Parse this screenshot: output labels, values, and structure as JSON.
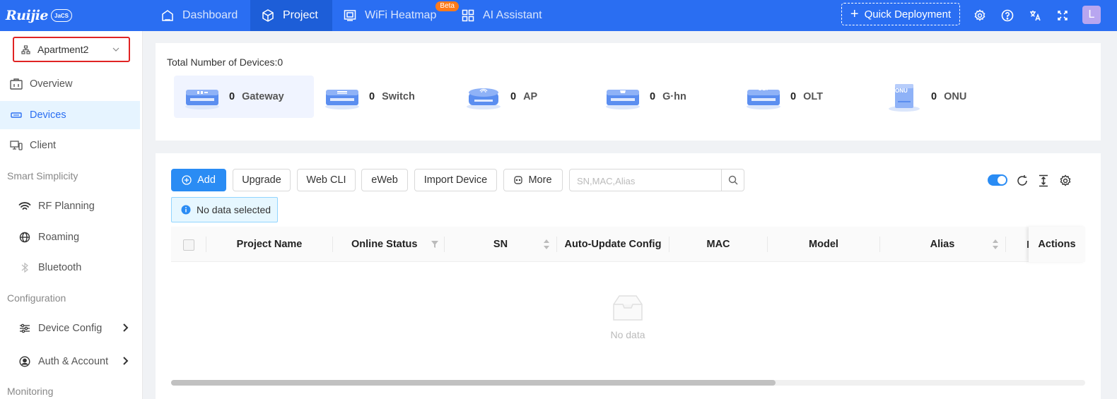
{
  "brand": {
    "logo_text": "Ruijie",
    "badge": "JaCS"
  },
  "nav": {
    "items": [
      {
        "label": "Dashboard",
        "icon": "home-icon"
      },
      {
        "label": "Project",
        "icon": "cube-icon"
      },
      {
        "label": "WiFi Heatmap",
        "icon": "heatmap-icon"
      },
      {
        "label": "AI Assistant",
        "icon": "grid-icon"
      }
    ],
    "beta_label": "Beta",
    "active": "Project",
    "quick_deployment": "Quick Deployment",
    "avatar_initial": "L"
  },
  "sidebar": {
    "project_selector": "Apartment2",
    "items": [
      {
        "label": "Overview",
        "icon": "overview-icon"
      },
      {
        "label": "Devices",
        "icon": "devices-icon",
        "active": true
      },
      {
        "label": "Client",
        "icon": "client-icon"
      }
    ],
    "groups": [
      "Smart Simplicity",
      "Configuration",
      "Monitoring"
    ],
    "smart_items": [
      {
        "label": "RF Planning",
        "icon": "wifi-icon"
      },
      {
        "label": "Roaming",
        "icon": "globe-icon"
      },
      {
        "label": "Bluetooth",
        "icon": "bluetooth-icon"
      }
    ],
    "config_items": [
      {
        "label": "Device Config",
        "icon": "sliders-icon"
      },
      {
        "label": "Auth & Account",
        "icon": "user-circle-icon"
      }
    ]
  },
  "summary": {
    "title": "Total Number of Devices:0",
    "device_types": [
      {
        "count": "0",
        "label": "Gateway"
      },
      {
        "count": "0",
        "label": "Switch"
      },
      {
        "count": "0",
        "label": "AP"
      },
      {
        "count": "0",
        "label": "G·hn"
      },
      {
        "count": "0",
        "label": "OLT"
      },
      {
        "count": "0",
        "label": "ONU"
      }
    ],
    "olt_badge": "OLT",
    "onu_badge": "ONU"
  },
  "toolbar": {
    "add": "Add",
    "upgrade": "Upgrade",
    "web_cli": "Web CLI",
    "eweb": "eWeb",
    "import": "Import Device",
    "more": "More",
    "search_placeholder": "SN,MAC,Alias"
  },
  "alert": {
    "text": "No data selected"
  },
  "table": {
    "columns": [
      "Project Name",
      "Online Status",
      "SN",
      "Auto-Update Config",
      "MAC",
      "Model",
      "Alias",
      "Actions"
    ],
    "empty_text": "No data"
  },
  "colors": {
    "primary": "#2a6ef2",
    "accent": "#2a8cf4",
    "selector_border": "#e02424"
  }
}
